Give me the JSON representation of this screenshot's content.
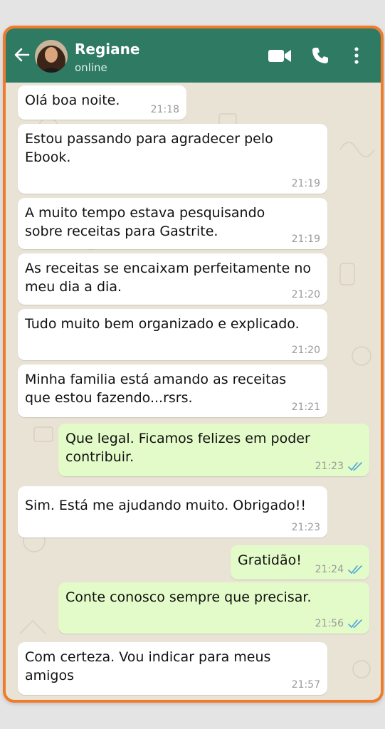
{
  "header": {
    "contact_name": "Regiane",
    "status": "online"
  },
  "icons": {
    "back": "arrow-left-icon",
    "video": "video-call-icon",
    "phone": "phone-call-icon",
    "menu": "more-vertical-icon",
    "read": "double-check-icon"
  },
  "colors": {
    "frame_border": "#f07b2a",
    "header_bg": "#2f7a63",
    "incoming_bubble": "#ffffff",
    "outgoing_bubble": "#e3fbc9",
    "read_ticks": "#4fa6d8"
  },
  "messages": [
    {
      "direction": "in",
      "lines": [
        "Olá boa noite."
      ],
      "time": "21:18"
    },
    {
      "direction": "in",
      "lines": [
        "Estou passando para agradecer pelo",
        "Ebook."
      ],
      "time": "21:19"
    },
    {
      "direction": "in",
      "lines": [
        "A muito tempo estava pesquisando",
        "sobre receitas para Gastrite."
      ],
      "time": "21:19"
    },
    {
      "direction": "in",
      "lines": [
        "As receitas se encaixam perfeitamente no",
        "meu dia a dia."
      ],
      "time": "21:20"
    },
    {
      "direction": "in",
      "lines": [
        "Tudo muito bem organizado e explicado."
      ],
      "time": "21:20"
    },
    {
      "direction": "in",
      "lines": [
        "Minha familia está amando as receitas",
        "que estou fazendo...rsrs."
      ],
      "time": "21:21"
    },
    {
      "direction": "out",
      "lines": [
        "Que legal. Ficamos felizes em poder",
        "contribuir."
      ],
      "time": "21:23"
    },
    {
      "direction": "in",
      "lines": [
        "Sim. Está me ajudando muito. Obrigado!!"
      ],
      "time": "21:23"
    },
    {
      "direction": "out",
      "lines": [
        "Gratidão!"
      ],
      "time": "21:24"
    },
    {
      "direction": "out",
      "lines": [
        "Conte conosco sempre que precisar."
      ],
      "time": "21:56"
    },
    {
      "direction": "in",
      "lines": [
        "Com certeza. Vou indicar para meus",
        "amigos"
      ],
      "time": "21:57"
    }
  ]
}
